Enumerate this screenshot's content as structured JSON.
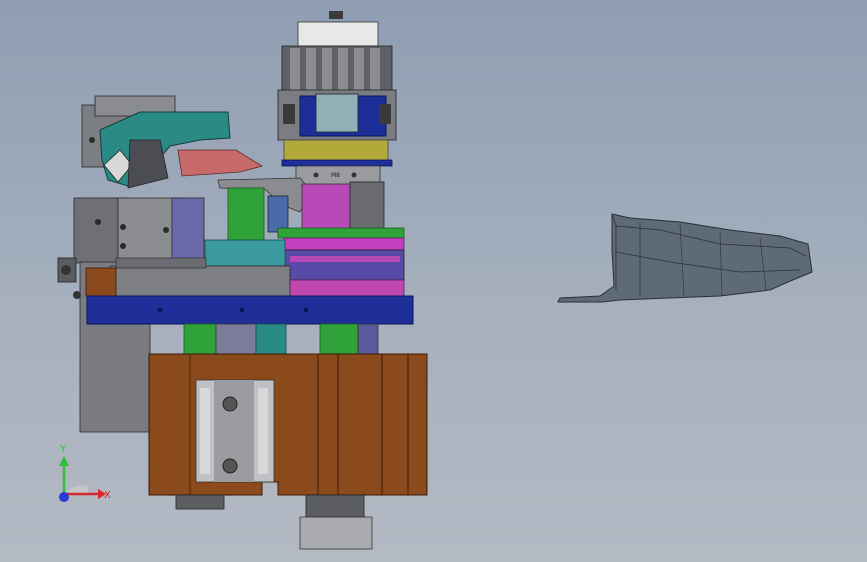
{
  "triad": {
    "x_label": "X",
    "y_label": "Y",
    "x_color": "#d9262a",
    "y_color": "#2fbf3a",
    "z_color": "#2a3bd4"
  },
  "assembly": {
    "part_mark": "M8"
  },
  "colors": {
    "background_top": "#8f9eb2",
    "background_bottom": "#b4bac4",
    "brown": "#8b4a1b",
    "navy": "#1e2f9a",
    "green": "#2fa23a",
    "magenta": "#c040c0",
    "teal": "#2a8a86",
    "gray": "#7d7f84",
    "olive": "#b3a83a",
    "salmon": "#c86a6a"
  }
}
